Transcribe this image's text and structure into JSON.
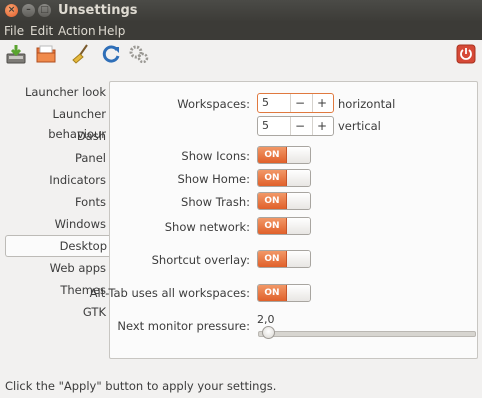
{
  "window": {
    "title": "Unsettings"
  },
  "menu": {
    "items": [
      "File",
      "Edit",
      "Action",
      "Help"
    ]
  },
  "toolbar": {
    "buttons": [
      {
        "icon": "save-icon"
      },
      {
        "icon": "folder-icon"
      },
      {
        "icon": "broom-icon"
      },
      {
        "icon": "refresh-icon"
      },
      {
        "icon": "gears-icon"
      },
      {
        "icon": "power-icon"
      }
    ]
  },
  "sidebar": {
    "items": [
      {
        "label": "Launcher look"
      },
      {
        "label": "Launcher behaviour"
      },
      {
        "label": "Dash"
      },
      {
        "label": "Panel"
      },
      {
        "label": "Indicators"
      },
      {
        "label": "Fonts"
      },
      {
        "label": "Windows"
      },
      {
        "label": "Desktop",
        "active": true
      },
      {
        "label": "Web apps"
      },
      {
        "label": "Themes"
      },
      {
        "label": "GTK"
      }
    ]
  },
  "desktop": {
    "workspaces": {
      "label": "Workspaces:",
      "horizontal": {
        "value": "5",
        "unit": "horizontal"
      },
      "vertical": {
        "value": "5",
        "unit": "vertical"
      },
      "minus": "−",
      "plus": "+"
    },
    "toggles": [
      {
        "label": "Show Icons:",
        "state": "ON"
      },
      {
        "label": "Show Home:",
        "state": "ON"
      },
      {
        "label": "Show Trash:",
        "state": "ON"
      },
      {
        "label": "Show network:",
        "state": "ON"
      },
      {
        "label": "Shortcut overlay:",
        "state": "ON"
      },
      {
        "label": "Alt-Tab uses all workspaces:",
        "state": "ON"
      }
    ],
    "monitor_pressure": {
      "label": "Next monitor pressure:",
      "value": "2,0",
      "fraction": 0.02
    }
  },
  "status": {
    "text": "Click the \"Apply\" button to apply your settings."
  },
  "colors": {
    "accent": "#e0602a",
    "titlebar": "#3c3b37",
    "power": "#d64937"
  }
}
